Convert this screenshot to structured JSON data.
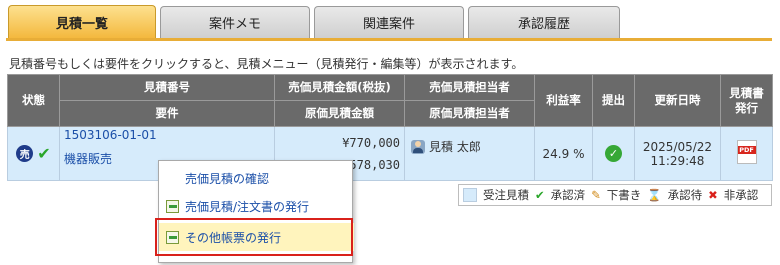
{
  "tabs": [
    {
      "label": "見積一覧",
      "active": true
    },
    {
      "label": "案件メモ",
      "active": false
    },
    {
      "label": "関連案件",
      "active": false
    },
    {
      "label": "承認履歴",
      "active": false
    }
  ],
  "notice": "見積番号もしくは要件をクリックすると、見積メニュー（見積発行・編集等）が表示されます。",
  "table": {
    "headers": {
      "status": "状態",
      "estimate_no": "見積番号",
      "requirement": "要件",
      "sales_amount": "売価見積金額(税抜)",
      "cost_amount": "原価見積金額",
      "sales_person": "売価見積担当者",
      "cost_person": "原価見積担当者",
      "margin": "利益率",
      "submit": "提出",
      "updated": "更新日時",
      "issue_line1": "見積書",
      "issue_line2": "発行"
    },
    "row": {
      "status_badge": "売",
      "estimate_no": "1503106-01-01",
      "requirement": "機器販売",
      "sales_amount": "¥770,000",
      "cost_amount": "¥578,030",
      "person": "見積 太郎",
      "margin": "24.9 %",
      "updated_date": "2025/05/22",
      "updated_time": "11:29:48",
      "pdf_label": "PDF"
    }
  },
  "legend": {
    "ordered": "受注見積",
    "approved": "承認済",
    "draft": "下書き",
    "pending": "承認待",
    "rejected": "非承認"
  },
  "context_menu": {
    "items": [
      {
        "label": "売価見積の確認",
        "icon": ""
      },
      {
        "label": "売価見積/注文書の発行",
        "icon": "document-icon"
      },
      {
        "label": "その他帳票の発行",
        "icon": "document-icon"
      }
    ]
  },
  "colors": {
    "tab_active": "#f3b73b",
    "row_bg": "#d6ebfb",
    "header_bg": "#6a6a6a",
    "highlight_border": "#d9211b"
  }
}
